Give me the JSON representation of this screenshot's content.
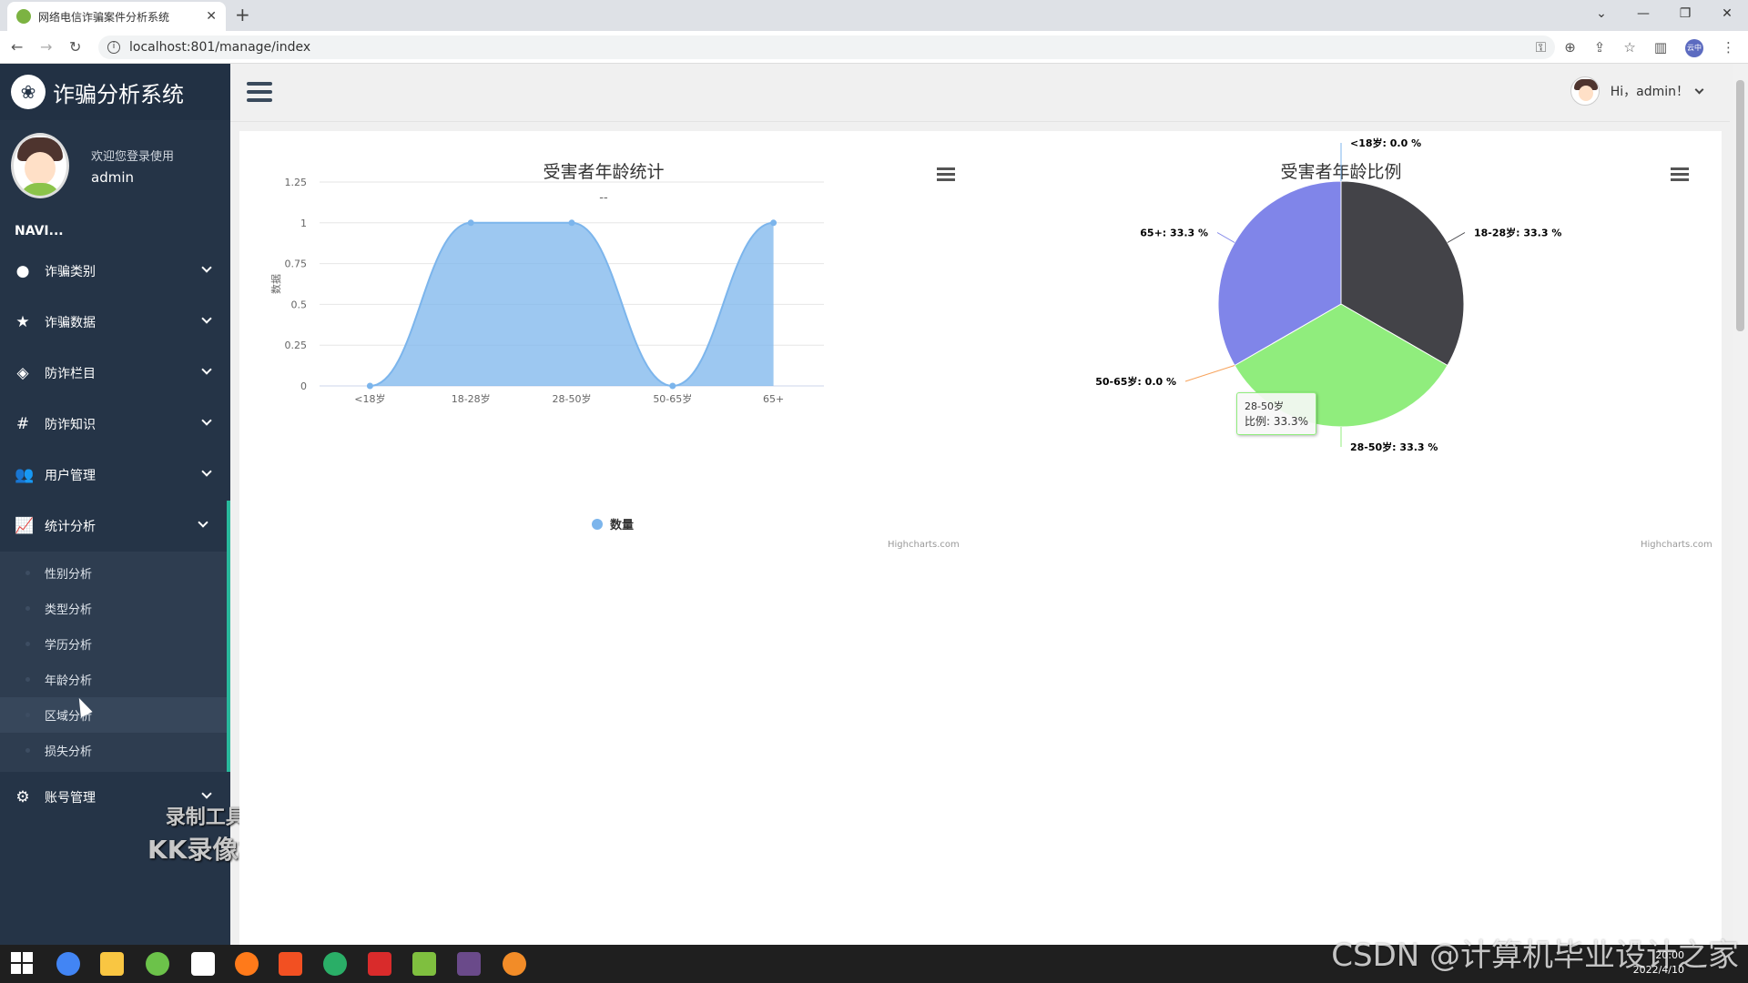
{
  "browser": {
    "tab_title": "网络电信诈骗案件分析系统",
    "url": "localhost:801/manage/index",
    "profile_badge": "云中"
  },
  "sidebar": {
    "brand": "诈骗分析系统",
    "welcome": "欢迎您登录使用",
    "username": "admin",
    "nav_label": "NAVI...",
    "items": [
      {
        "label": "诈骗类别",
        "icon": "circle-icon"
      },
      {
        "label": "诈骗数据",
        "icon": "star-icon"
      },
      {
        "label": "防诈栏目",
        "icon": "cube-icon"
      },
      {
        "label": "防诈知识",
        "icon": "hashtag-icon"
      },
      {
        "label": "用户管理",
        "icon": "users-icon"
      },
      {
        "label": "统计分析",
        "icon": "line-chart-icon"
      },
      {
        "label": "账号管理",
        "icon": "gear-icon"
      }
    ],
    "subitems": [
      "性别分析",
      "类型分析",
      "学历分析",
      "年龄分析",
      "区域分析",
      "损失分析"
    ]
  },
  "header": {
    "greeting": "Hi，admin！"
  },
  "watermark": {
    "line1": "录制工具",
    "line2": "KK录像机"
  },
  "csdn_watermark": "CSDN @计算机毕业设计之家",
  "tray": {
    "time": "20:00",
    "date": "2022/4/10"
  },
  "credits": "Highcharts.com",
  "colors": {
    "area": "#7cb5ec",
    "sidebar": "#253447",
    "accent": "#29b99c"
  },
  "chart_data": [
    {
      "type": "area",
      "title": "受害者年龄统计",
      "subtitle": "--",
      "ylabel": "数据",
      "categories": [
        "<18岁",
        "18-28岁",
        "28-50岁",
        "50-65岁",
        "65+"
      ],
      "series": [
        {
          "name": "数量",
          "values": [
            0,
            1,
            1,
            0,
            1
          ]
        }
      ],
      "ylim": [
        0,
        1.25
      ],
      "yticks": [
        "0",
        "0.25",
        "0.5",
        "0.75",
        "1",
        "1.25"
      ],
      "grid": true,
      "legend": "bottom-center"
    },
    {
      "type": "pie",
      "title": "受害者年龄比例",
      "slices": [
        {
          "name": "<18岁",
          "value": 0.0,
          "label": "<18岁: 0.0 %",
          "color": "#7cb5ec"
        },
        {
          "name": "18-28岁",
          "value": 33.3,
          "label": "18-28岁: 33.3 %",
          "color": "#434348"
        },
        {
          "name": "28-50岁",
          "value": 33.3,
          "label": "28-50岁: 33.3 %",
          "color": "#90ed7d"
        },
        {
          "name": "50-65岁",
          "value": 0.0,
          "label": "50-65岁: 0.0 %",
          "color": "#f7a35c"
        },
        {
          "name": "65+",
          "value": 33.3,
          "label": "65+: 33.3 %",
          "color": "#8085e9"
        }
      ],
      "tooltip": {
        "title": "28-50岁",
        "text": "比例: 33.3%"
      }
    }
  ]
}
